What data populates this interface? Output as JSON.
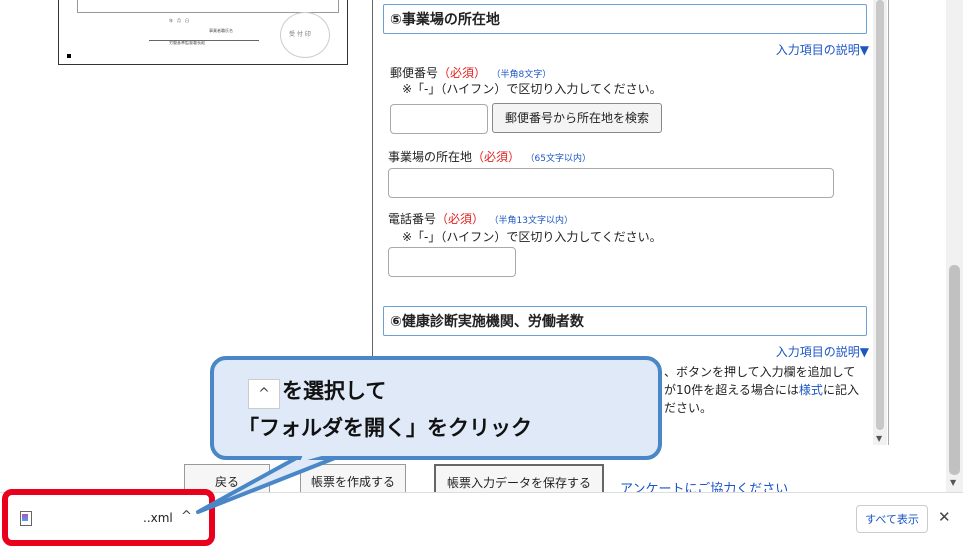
{
  "preview": {
    "tiny_texts": [
      "年　月　日",
      "事業者職氏名",
      "労働基準監督署長殿",
      "受 付 印"
    ]
  },
  "section5": {
    "title": "⑤事業場の所在地",
    "help": "入力項目の説明▼",
    "postal": {
      "label": "郵便番号",
      "required": "（必須）",
      "hint": "（半角8文字）",
      "note": "※「-」（ハイフン）で区切り入力してください。",
      "search_button": "郵便番号から所在地を検索",
      "value": ""
    },
    "address": {
      "label": "事業場の所在地",
      "required": "（必須）",
      "hint": "（65文字以内）",
      "value": ""
    },
    "phone": {
      "label": "電話番号",
      "required": "（必須）",
      "hint": "（半角13文字以内）",
      "note": "※「-」（ハイフン）で区切り入力してください。",
      "value": ""
    }
  },
  "section6": {
    "title": "⑥健康診断実施機関、労働者数",
    "help": "入力項目の説明▼",
    "body_line1": "、ボタンを押して入力欄を追加して",
    "body_line2_pre": "が10件を超える場合には",
    "body_line2_link": "様式",
    "body_line2_post": "に記入",
    "body_line3": "ださい。"
  },
  "bottom_buttons": {
    "back": "戻る",
    "create": "帳票を作成する",
    "save": "帳票入力データを保存する",
    "survey": "アンケートにご協力ください"
  },
  "download_bar": {
    "file_name": "..xml",
    "caret": "^",
    "show_all": "すべて表示",
    "close": "✕"
  },
  "callout": {
    "caret_glyph": "^",
    "line1": "を選択して",
    "line2": "「フォルダを開く」をクリック"
  }
}
